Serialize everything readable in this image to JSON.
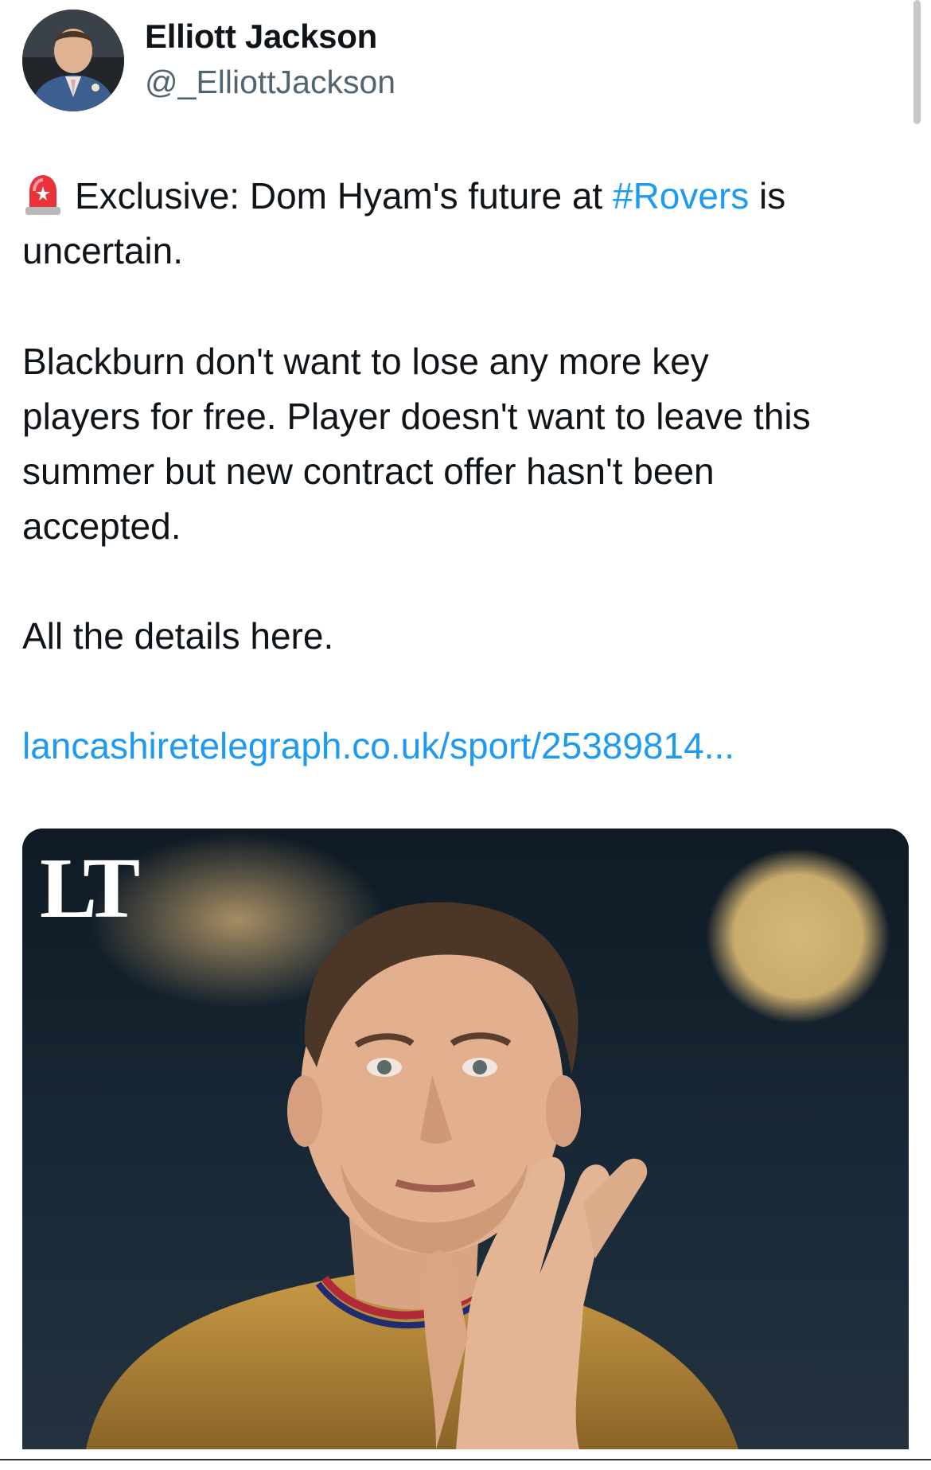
{
  "author": {
    "name": "Elliott Jackson",
    "handle": "@_ElliottJackson"
  },
  "tweet": {
    "intro_icon": "siren-icon",
    "intro_before": "Exclusive: Dom Hyam's future at ",
    "hashtag": "#Rovers",
    "intro_after_line1": " is",
    "intro_line2": "uncertain.",
    "body_line1": "Blackburn don't want to lose any more key",
    "body_line2": "players for free. Player doesn't want to leave this",
    "body_line3": "summer but new contract offer hasn't been",
    "body_line4": "accepted.",
    "details": "All the details here.",
    "link_text": "lancashiretelegraph.co.uk/sport/25389814..."
  },
  "media": {
    "brand_logo": "LT",
    "image_subject": "player-photo"
  },
  "colors": {
    "link": "#1d9bf0",
    "text": "#0f1419",
    "secondary": "#536471"
  }
}
